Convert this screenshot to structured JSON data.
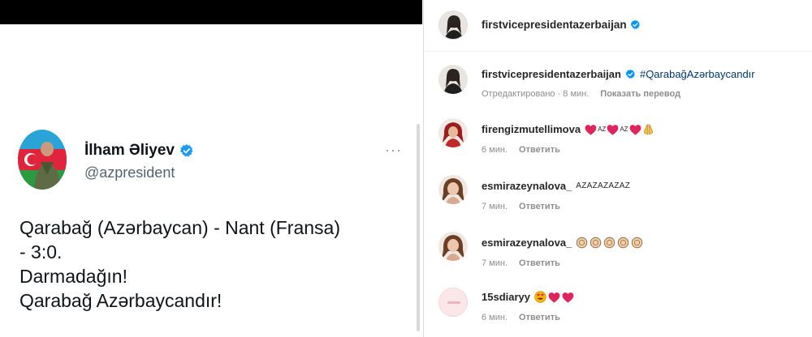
{
  "tweet": {
    "name": "İlham Əliyev",
    "handle": "@azpresident",
    "more": "···",
    "lines": [
      "Qarabağ (Azərbaycan) - Nant (Fransa)",
      "- 3:0.",
      "Darmadağın!",
      "Qarabağ Azərbaycandır!"
    ]
  },
  "instagram": {
    "header_user": "firstvicepresidentazerbaijan",
    "caption": {
      "user": "firstvicepresidentazerbaijan",
      "hashtag": "#QarabağAzərbaycandır",
      "meta_edited": "Отредактировано · 8 мин.",
      "meta_translate": "Показать перевод"
    },
    "comments": [
      {
        "user": "firengizmutellimova",
        "text_parts": [
          "AZ",
          "AZ"
        ],
        "time": "6 мин.",
        "reply": "Ответить"
      },
      {
        "user": "esmirazeynalova_",
        "text": "AZAZAZAZAZ",
        "time": "7 мин.",
        "reply": "Ответить"
      },
      {
        "user": "esmirazeynalova_",
        "time": "7 мин.",
        "reply": "Ответить"
      },
      {
        "user": "15sdiaryy",
        "time": "6 мин.",
        "reply": "Ответить"
      }
    ]
  },
  "colors": {
    "verified": "#1d9bf0",
    "ig_verified": "#0095f6",
    "heart": "#e0245e",
    "clap": "#f2cfa5"
  },
  "icons": [
    "verified-badge-icon",
    "more-options-icon",
    "heart-emoji-icon",
    "clap-emoji-icon",
    "heart-eyes-emoji-icon",
    "folded-hands-emoji-icon"
  ]
}
